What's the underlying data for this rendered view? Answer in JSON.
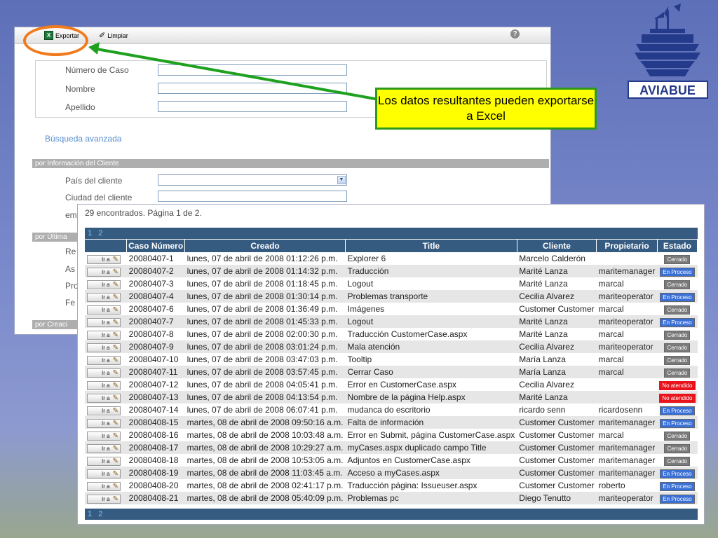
{
  "toolbar": {
    "export_label": "Exportar",
    "clear_label": "Limpiar"
  },
  "search": {
    "fields": [
      {
        "label": "Número de Caso",
        "value": ""
      },
      {
        "label": "Nombre",
        "value": ""
      },
      {
        "label": "Apellido",
        "value": ""
      }
    ],
    "advanced_link": "Búsqueda avanzada",
    "sections": {
      "client_info": "por Información del Cliente",
      "last": "por Última",
      "creation": "por Creaci"
    },
    "client_fields": {
      "country_label": "País del cliente",
      "country_value": "",
      "city_label": "Ciudad del cliente",
      "city_value": "",
      "partial_label": "em"
    },
    "last_partial_labels": [
      "Re",
      "As",
      "Pro",
      "Fe"
    ]
  },
  "callout": {
    "text": "Los datos resultantes pueden exportarse a Excel"
  },
  "logo": {
    "text": "AVIABUE"
  },
  "results": {
    "summary": "29 encontrados. Página 1 de 2.",
    "pages": [
      "1",
      "2"
    ],
    "action_label": "Ir a",
    "columns": [
      "",
      "Caso Número",
      "Creado",
      "Title",
      "Cliente",
      "Propietario",
      "Estado"
    ],
    "rows": [
      {
        "caso": "20080407-1",
        "creado": "lunes, 07 de abril de 2008 01:12:26 p.m.",
        "title": "Explorer 6",
        "cliente": "Marcelo Calderón",
        "propietario": "",
        "estado": "Cerrado"
      },
      {
        "caso": "20080407-2",
        "creado": "lunes, 07 de abril de 2008 01:14:32 p.m.",
        "title": "Traducción",
        "cliente": "Marité Lanza",
        "propietario": "maritemanager",
        "estado": "En Proceso"
      },
      {
        "caso": "20080407-3",
        "creado": "lunes, 07 de abril de 2008 01:18:45 p.m.",
        "title": "Logout",
        "cliente": "Marité Lanza",
        "propietario": "marcal",
        "estado": "Cerrado"
      },
      {
        "caso": "20080407-4",
        "creado": "lunes, 07 de abril de 2008 01:30:14 p.m.",
        "title": "Problemas transporte",
        "cliente": "Cecilia Alvarez",
        "propietario": "mariteoperator",
        "estado": "En Proceso"
      },
      {
        "caso": "20080407-6",
        "creado": "lunes, 07 de abril de 2008 01:36:49 p.m.",
        "title": "Imágenes",
        "cliente": "Customer Customer",
        "propietario": "marcal",
        "estado": "Cerrado"
      },
      {
        "caso": "20080407-7",
        "creado": "lunes, 07 de abril de 2008 01:45:33 p.m.",
        "title": "Logout",
        "cliente": "Marité Lanza",
        "propietario": "mariteoperator",
        "estado": "En Proceso"
      },
      {
        "caso": "20080407-8",
        "creado": "lunes, 07 de abril de 2008 02:00:30 p.m.",
        "title": "Traducción CustomerCase.aspx",
        "cliente": "Marité Lanza",
        "propietario": "marcal",
        "estado": "Cerrado"
      },
      {
        "caso": "20080407-9",
        "creado": "lunes, 07 de abril de 2008 03:01:24 p.m.",
        "title": "Mala atención",
        "cliente": "Cecilia Alvarez",
        "propietario": "mariteoperator",
        "estado": "Cerrado"
      },
      {
        "caso": "20080407-10",
        "creado": "lunes, 07 de abril de 2008 03:47:03 p.m.",
        "title": "Tooltip",
        "cliente": "María Lanza",
        "propietario": "marcal",
        "estado": "Cerrado"
      },
      {
        "caso": "20080407-11",
        "creado": "lunes, 07 de abril de 2008 03:57:45 p.m.",
        "title": "Cerrar Caso",
        "cliente": "María Lanza",
        "propietario": "marcal",
        "estado": "Cerrado"
      },
      {
        "caso": "20080407-12",
        "creado": "lunes, 07 de abril de 2008 04:05:41 p.m.",
        "title": "Error en CustomerCase.aspx",
        "cliente": "Cecilia Alvarez",
        "propietario": "",
        "estado": "No atendido"
      },
      {
        "caso": "20080407-13",
        "creado": "lunes, 07 de abril de 2008 04:13:54 p.m.",
        "title": "Nombre de la página Help.aspx",
        "cliente": "Marité Lanza",
        "propietario": "",
        "estado": "No atendido"
      },
      {
        "caso": "20080407-14",
        "creado": "lunes, 07 de abril de 2008 06:07:41 p.m.",
        "title": "mudanca do escritorio",
        "cliente": "ricardo senn",
        "propietario": "ricardosenn",
        "estado": "En Proceso"
      },
      {
        "caso": "20080408-15",
        "creado": "martes, 08 de abril de 2008 09:50:16 a.m.",
        "title": "Falta de información",
        "cliente": "Customer Customer",
        "propietario": "maritemanager",
        "estado": "En Proceso"
      },
      {
        "caso": "20080408-16",
        "creado": "martes, 08 de abril de 2008 10:03:48 a.m.",
        "title": "Error en Submit, página CustomerCase.aspx",
        "cliente": "Customer Customer",
        "propietario": "marcal",
        "estado": "Cerrado"
      },
      {
        "caso": "20080408-17",
        "creado": "martes, 08 de abril de 2008 10:29:27 a.m.",
        "title": "myCases.aspx duplicado campo Title",
        "cliente": "Customer Customer",
        "propietario": "maritemanager",
        "estado": "Cerrado"
      },
      {
        "caso": "20080408-18",
        "creado": "martes, 08 de abril de 2008 10:53:05 a.m.",
        "title": "Adjuntos en CustomerCase.aspx",
        "cliente": "Customer Customer",
        "propietario": "maritemanager",
        "estado": "Cerrado"
      },
      {
        "caso": "20080408-19",
        "creado": "martes, 08 de abril de 2008 11:03:45 a.m.",
        "title": "Acceso a myCases.aspx",
        "cliente": "Customer Customer",
        "propietario": "maritemanager",
        "estado": "En Proceso"
      },
      {
        "caso": "20080408-20",
        "creado": "martes, 08 de abril de 2008 02:41:17 p.m.",
        "title": "Traducción página: Issueuser.aspx",
        "cliente": "Customer Customer",
        "propietario": "roberto",
        "estado": "En Proceso"
      },
      {
        "caso": "20080408-21",
        "creado": "martes, 08 de abril de 2008 05:40:09 p.m.",
        "title": "Problemas pc",
        "cliente": "Diego Tenutto",
        "propietario": "mariteoperator",
        "estado": "En Proceso"
      }
    ]
  },
  "colors": {
    "table_header": "#365b80",
    "callout_bg": "#ffff00",
    "callout_border": "#2f9a1a",
    "highlight": "#f07a1c",
    "status_closed": "#7a7a7a",
    "status_in_progress": "#3a6fd6",
    "status_unattended": "#e8141c"
  }
}
